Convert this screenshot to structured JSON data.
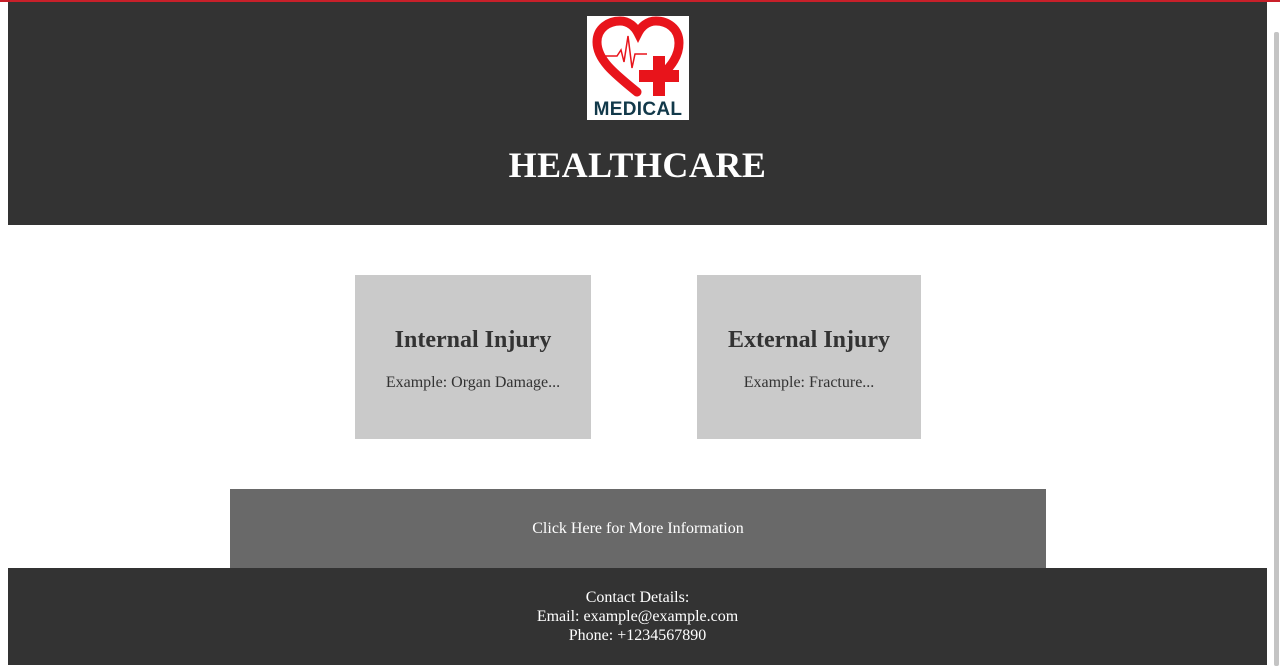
{
  "header": {
    "logo_text": "MEDICAL",
    "title": "HEALTHCARE"
  },
  "cards": [
    {
      "title": "Internal Injury",
      "text": "Example: Organ Damage..."
    },
    {
      "title": "External Injury",
      "text": "Example: Fracture..."
    }
  ],
  "more_info": {
    "label": "Click Here for More Information"
  },
  "footer": {
    "heading": "Contact Details:",
    "email": "Email: example@example.com",
    "phone": "Phone: +1234567890"
  },
  "colors": {
    "header_bg": "#333333",
    "card_bg": "#cacaca",
    "button_bg": "#696969",
    "logo_red": "#e8141b",
    "logo_text": "#12394a",
    "accent_line": "#c8202a"
  }
}
